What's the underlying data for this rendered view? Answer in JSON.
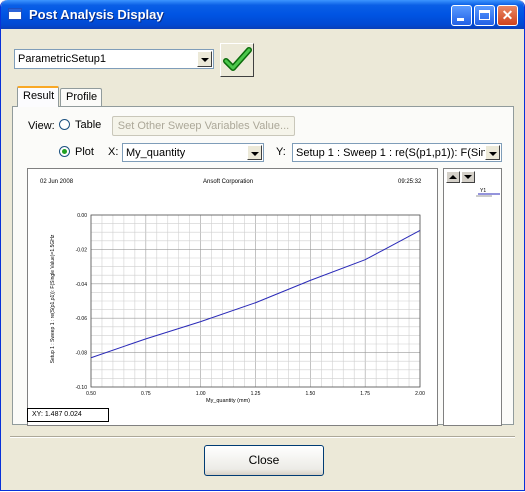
{
  "window": {
    "title": "Post Analysis Display"
  },
  "setup_select": {
    "value": "ParametricSetup1"
  },
  "tabs": [
    {
      "label": "Result"
    },
    {
      "label": "Profile"
    }
  ],
  "view": {
    "label": "View:",
    "table_label": "Table",
    "plot_label": "Plot",
    "sweep_button": "Set Other Sweep Variables Value...",
    "x_label": "X:",
    "x_value": "My_quantity",
    "y_label": "Y:",
    "y_value": "Setup 1 : Sweep 1 : re(S(p1,p1)): F(Sing"
  },
  "plot": {
    "date": "02 Jun 2008",
    "company": "Ansoft Corporation",
    "time": "09:25:32",
    "readout": "XY: 1.487 0.024"
  },
  "legend": {
    "entry": "Y1"
  },
  "chart_data": {
    "type": "line",
    "xlabel": "My_quantity (mm)",
    "ylabel": "Setup 1 : Sweep 1 : re(S(p1,p1)): F(Single Value)=1.5GHz",
    "xlim": [
      0.5,
      2.0
    ],
    "ylim": [
      -0.1,
      0.0
    ],
    "x_ticks": [
      "0.50",
      "0.75",
      "1.00",
      "1.25",
      "1.50",
      "1.75",
      "2.00"
    ],
    "y_ticks": [
      "0.00",
      "-0.02",
      "-0.04",
      "-0.06",
      "-0.08",
      "-0.10"
    ],
    "grid": true,
    "series": [
      {
        "color": "#2a2ab8",
        "x": [
          0.5,
          0.75,
          1.0,
          1.25,
          1.5,
          1.75,
          2.0
        ],
        "y": [
          -0.083,
          -0.072,
          -0.062,
          -0.051,
          -0.038,
          -0.026,
          -0.009
        ]
      }
    ]
  },
  "footer": {
    "close_label": "Close"
  }
}
